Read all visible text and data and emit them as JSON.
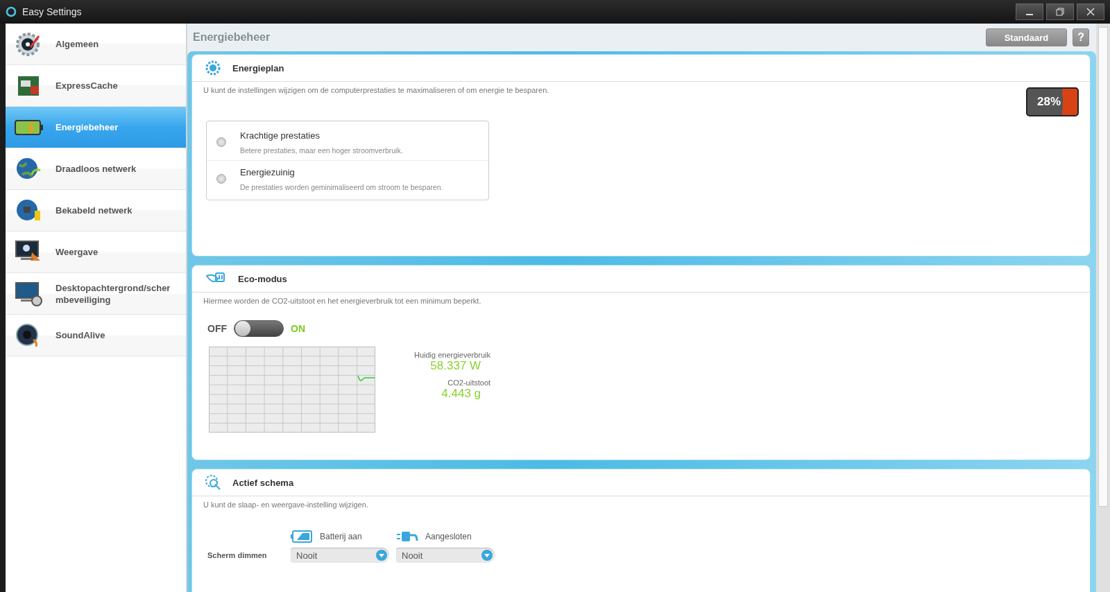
{
  "window": {
    "title": "Easy Settings"
  },
  "sidebar": {
    "items": [
      {
        "label": "Algemeen",
        "selected": false
      },
      {
        "label": "ExpressCache",
        "selected": false
      },
      {
        "label": "Energiebeheer",
        "selected": true
      },
      {
        "label": "Draadloos netwerk",
        "selected": false
      },
      {
        "label": "Bekabeld netwerk",
        "selected": false
      },
      {
        "label": "Weergave",
        "selected": false
      },
      {
        "label": "Desktopachtergrond/scher mbeveiliging",
        "selected": false
      },
      {
        "label": "SoundAlive",
        "selected": false
      }
    ]
  },
  "page": {
    "title": "Energiebeheer",
    "buttons": [
      {
        "label": "Standaard",
        "kind": "text"
      },
      {
        "label": "?",
        "kind": "help"
      }
    ]
  },
  "energy_plan": {
    "title": "Energieplan",
    "description": "U kunt de instellingen wijzigen om de computerprestaties te maximaliseren of om energie te besparen.",
    "battery_reading": "28%",
    "options": [
      {
        "label": "Krachtige prestaties",
        "detail": "Betere prestaties, maar een hoger stroomverbruik.",
        "selected": false
      },
      {
        "label": "Energiezuinig",
        "detail": "De prestaties worden geminimaliseerd om stroom te besparen.",
        "selected": false
      }
    ]
  },
  "eco_mode": {
    "title": "Eco-modus",
    "description": "Hiermee worden de CO2-uitstoot en het energieverbruik tot een minimum beperkt.",
    "off_label": "OFF",
    "on_label": "ON",
    "on": false,
    "readings": [
      {
        "label": "Huidig energieverbruik",
        "value": "58.337 W"
      },
      {
        "label": "CO2-uitstoot",
        "value": "4.443 g"
      }
    ]
  },
  "active_scheme": {
    "title": "Actief schema",
    "description": "U kunt de slaap- en weergave-instelling wijzigen.",
    "columns": [
      {
        "label": "Batterij aan"
      },
      {
        "label": "Aangesloten"
      }
    ],
    "rows": [
      {
        "label": "Scherm dimmen",
        "values": [
          "Nooit",
          "Nooit"
        ]
      }
    ]
  }
}
